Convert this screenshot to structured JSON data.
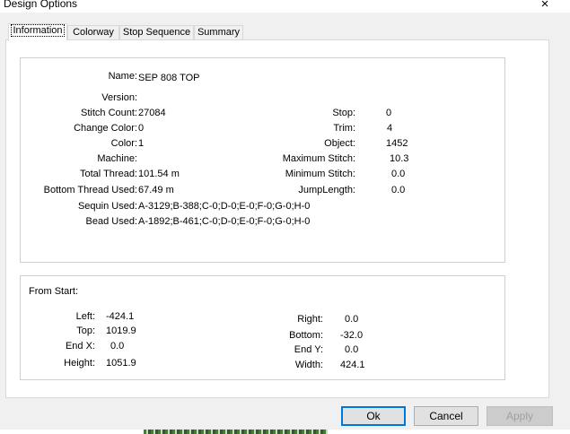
{
  "window": {
    "title": "Design Options",
    "close_glyph": "×"
  },
  "tabs": [
    {
      "label": "Information",
      "active": true
    },
    {
      "label": "Colorway",
      "active": false
    },
    {
      "label": "Stop Sequence",
      "active": false
    },
    {
      "label": "Summary",
      "active": false
    }
  ],
  "info": {
    "name_label": "Name:",
    "name_value": "SEP 808 TOP",
    "version_label": "Version:",
    "version_value": "",
    "stitch_count_label": "Stitch Count:",
    "stitch_count_value": "27084",
    "change_color_label": "Change Color:",
    "change_color_value": "0",
    "color_label": "Color:",
    "color_value": "1",
    "machine_label": "Machine:",
    "machine_value": "",
    "total_thread_label": "Total Thread:",
    "total_thread_value": "101.54 m",
    "bottom_thread_label": "Bottom Thread Used:",
    "bottom_thread_value": "67.49 m",
    "sequin_label": "Sequin Used:",
    "sequin_value": "A-3129;B-388;C-0;D-0;E-0;F-0;G-0;H-0",
    "bead_label": "Bead Used:",
    "bead_value": "A-1892;B-461;C-0;D-0;E-0;F-0;G-0;H-0",
    "stop_label": "Stop:",
    "stop_value": "0",
    "trim_label": "Trim:",
    "trim_value": "4",
    "object_label": "Object:",
    "object_value": "1452",
    "max_stitch_label": "Maximum Stitch:",
    "max_stitch_value": "10.3",
    "min_stitch_label": "Minimum Stitch:",
    "min_stitch_value": "0.0",
    "jump_length_label": "JumpLength:",
    "jump_length_value": "0.0"
  },
  "from_start": {
    "heading": "From Start:",
    "left_label": "Left:",
    "left_value": "-424.1",
    "top_label": "Top:",
    "top_value": "1019.9",
    "end_x_label": "End X:",
    "end_x_value": "0.0",
    "height_label": "Height:",
    "height_value": "1051.9",
    "right_label": "Right:",
    "right_value": "0.0",
    "bottom_label": "Bottom:",
    "bottom_value": "-32.0",
    "end_y_label": "End Y:",
    "end_y_value": "0.0",
    "width_label": "Width:",
    "width_value": "424.1"
  },
  "buttons": {
    "ok": "Ok",
    "cancel": "Cancel",
    "apply": "Apply"
  },
  "colors": {
    "dialog_bg": "#f0f0f0",
    "focus_border": "#0078d7",
    "panel_border": "#d9d9d9"
  }
}
